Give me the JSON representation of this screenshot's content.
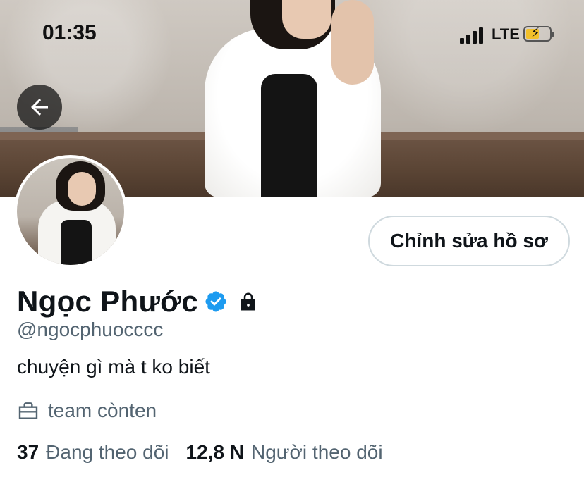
{
  "status_bar": {
    "time": "01:35",
    "network": "LTE",
    "battery_charging": true
  },
  "profile": {
    "display_name": "Ngọc Phước",
    "handle": "@ngocphuocccc",
    "bio": "chuyện gì mà t ko biết",
    "job": "team cònten",
    "verified": true,
    "protected": true
  },
  "actions": {
    "edit_profile_label": "Chỉnh sửa hồ sơ"
  },
  "stats": {
    "following_count": "37",
    "following_label": "Đang theo dõi",
    "followers_count": "12,8 N",
    "followers_label": "Người theo dõi"
  },
  "colors": {
    "verified_blue": "#1d9bf0",
    "secondary_text": "#536471",
    "battery_yellow": "#f2c02a"
  },
  "icons": {
    "back": "arrow-left-icon",
    "verified": "verified-badge-icon",
    "lock": "lock-icon",
    "job": "briefcase-icon"
  }
}
